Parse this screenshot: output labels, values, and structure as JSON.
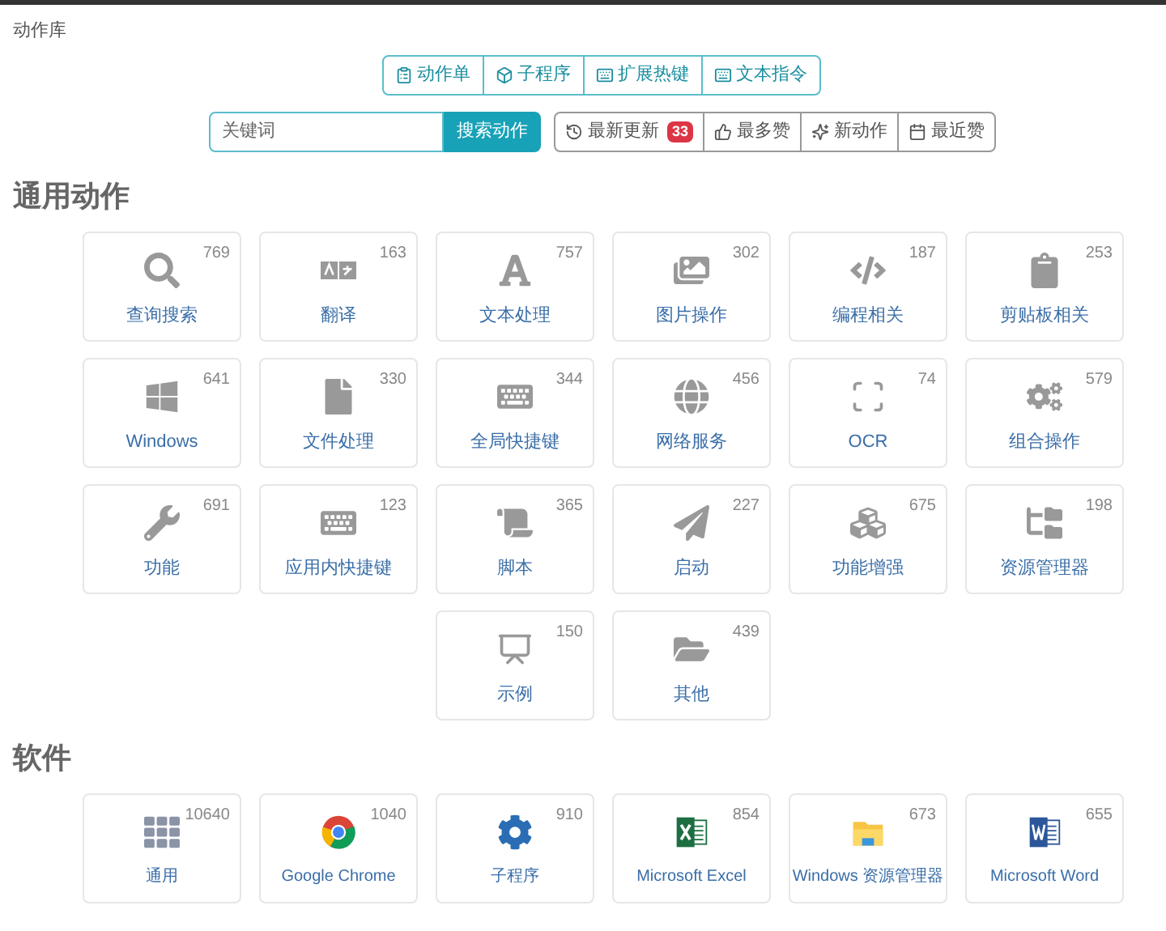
{
  "breadcrumb": "动作库",
  "nav_tabs": [
    {
      "label": "动作单"
    },
    {
      "label": "子程序"
    },
    {
      "label": "扩展热键"
    },
    {
      "label": "文本指令"
    }
  ],
  "search": {
    "placeholder": "关键词",
    "button": "搜索动作"
  },
  "filters": [
    {
      "label": "最新更新",
      "badge": "33"
    },
    {
      "label": "最多赞"
    },
    {
      "label": "新动作"
    },
    {
      "label": "最近赞"
    }
  ],
  "sections": [
    {
      "title": "通用动作",
      "cards": [
        {
          "label": "查询搜索",
          "count": "769"
        },
        {
          "label": "翻译",
          "count": "163"
        },
        {
          "label": "文本处理",
          "count": "757"
        },
        {
          "label": "图片操作",
          "count": "302"
        },
        {
          "label": "编程相关",
          "count": "187"
        },
        {
          "label": "剪贴板相关",
          "count": "253"
        },
        {
          "label": "Windows",
          "count": "641"
        },
        {
          "label": "文件处理",
          "count": "330"
        },
        {
          "label": "全局快捷键",
          "count": "344"
        },
        {
          "label": "网络服务",
          "count": "456"
        },
        {
          "label": "OCR",
          "count": "74"
        },
        {
          "label": "组合操作",
          "count": "579"
        },
        {
          "label": "功能",
          "count": "691"
        },
        {
          "label": "应用内快捷键",
          "count": "123"
        },
        {
          "label": "脚本",
          "count": "365"
        },
        {
          "label": "启动",
          "count": "227"
        },
        {
          "label": "功能增强",
          "count": "675"
        },
        {
          "label": "资源管理器",
          "count": "198"
        },
        {
          "label": "示例",
          "count": "150"
        },
        {
          "label": "其他",
          "count": "439"
        }
      ]
    },
    {
      "title": "软件",
      "cards": [
        {
          "label": "通用",
          "count": "10640"
        },
        {
          "label": "Google Chrome",
          "count": "1040"
        },
        {
          "label": "子程序",
          "count": "910"
        },
        {
          "label": "Microsoft Excel",
          "count": "854"
        },
        {
          "label": "Windows 资源管理器",
          "count": "673"
        },
        {
          "label": "Microsoft Word",
          "count": "655"
        }
      ]
    }
  ]
}
